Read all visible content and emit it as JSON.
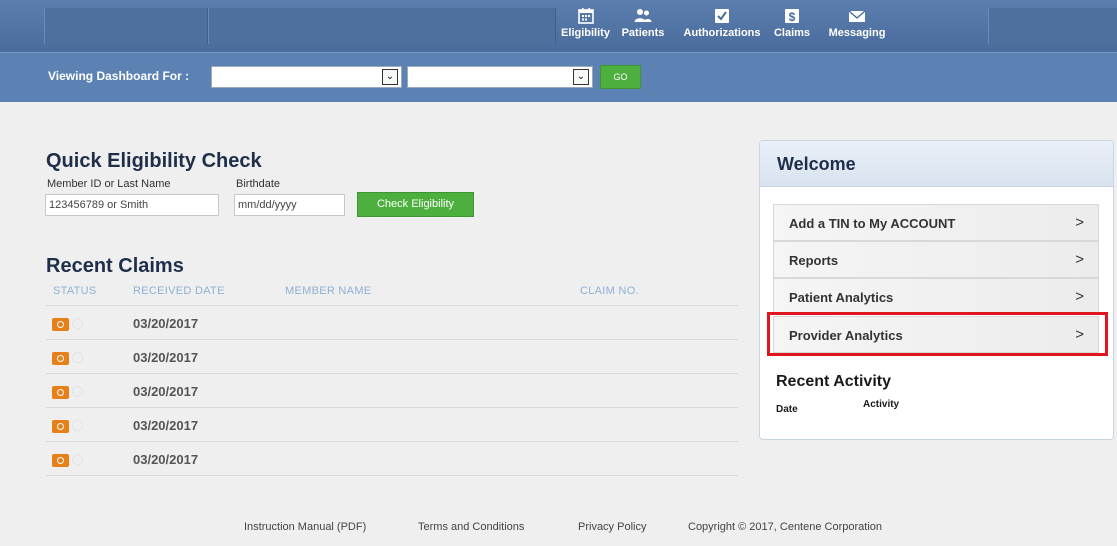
{
  "nav": {
    "items": [
      {
        "label": "Eligibility",
        "icon": "calendar-icon"
      },
      {
        "label": "Patients",
        "icon": "people-icon"
      },
      {
        "label": "Authorizations",
        "icon": "checkbox-icon"
      },
      {
        "label": "Claims",
        "icon": "dollar-icon"
      },
      {
        "label": "Messaging",
        "icon": "envelope-icon"
      }
    ]
  },
  "dashboard": {
    "label": "Viewing Dashboard For :",
    "select1_value": "",
    "select2_value": "",
    "go_label": "GO"
  },
  "quick_eligibility": {
    "title": "Quick Eligibility Check",
    "member_label": "Member ID or Last Name",
    "member_placeholder": "123456789 or Smith",
    "birthdate_label": "Birthdate",
    "birthdate_placeholder": "mm/dd/yyyy",
    "button_label": "Check Eligibility"
  },
  "recent_claims": {
    "title": "Recent Claims",
    "headers": {
      "status": "STATUS",
      "received": "RECEIVED DATE",
      "member": "MEMBER NAME",
      "claim": "CLAIM NO."
    },
    "rows": [
      {
        "received": "03/20/2017"
      },
      {
        "received": "03/20/2017"
      },
      {
        "received": "03/20/2017"
      },
      {
        "received": "03/20/2017"
      },
      {
        "received": "03/20/2017"
      }
    ]
  },
  "welcome": {
    "title": "Welcome",
    "items": [
      {
        "label": "Add a TIN to My ACCOUNT",
        "chevron": ">"
      },
      {
        "label": "Reports",
        "chevron": ">"
      },
      {
        "label": "Patient Analytics",
        "chevron": ">"
      },
      {
        "label": "Provider Analytics",
        "chevron": ">"
      }
    ],
    "recent_activity_title": "Recent Activity",
    "col_date": "Date",
    "col_activity": "Activity"
  },
  "footer": {
    "manual": "Instruction Manual (PDF)",
    "terms": "Terms and Conditions",
    "privacy": "Privacy Policy",
    "copyright": "Copyright © 2017, Centene Corporation"
  },
  "colors": {
    "topbar": "#4a6c9c",
    "dashbar": "#5c82b4",
    "green_button": "#4caf3e",
    "status_orange": "#e8801a",
    "highlight_red": "#e0161e",
    "title_navy": "#1f2f4a"
  }
}
